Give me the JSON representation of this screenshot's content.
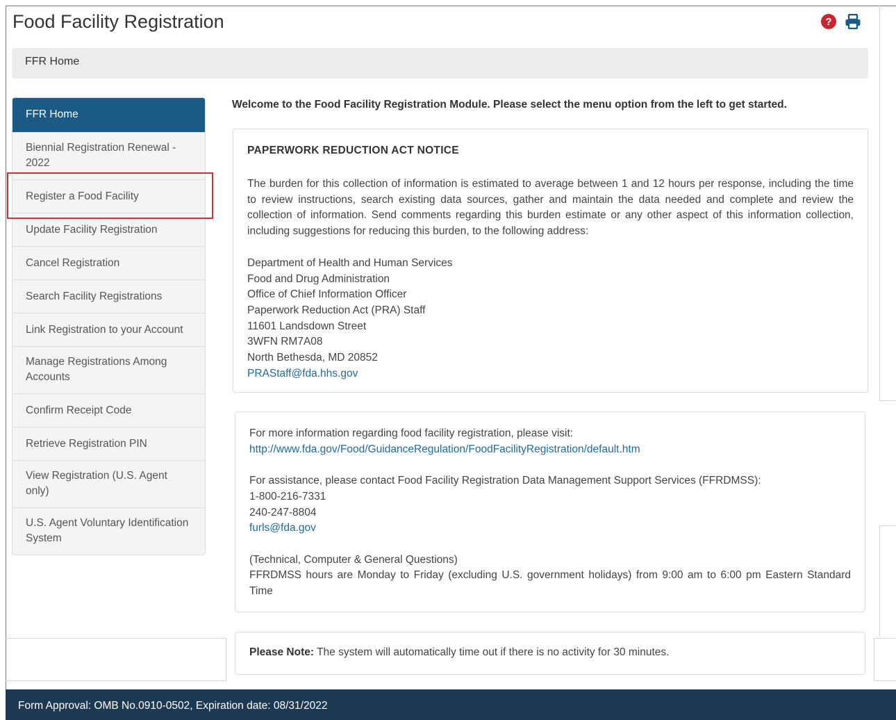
{
  "header": {
    "title": "Food Facility Registration",
    "help_icon": "question-circle-icon",
    "print_icon": "print-icon",
    "accent_color": "#c9252c",
    "icon_color": "#1b5a85"
  },
  "breadcrumb": {
    "label": "FFR Home"
  },
  "sidebar": {
    "active_color": "#1b5a85",
    "items": [
      {
        "label": "FFR Home"
      },
      {
        "label": "Biennial Registration Renewal - 2022"
      },
      {
        "label": "Register a Food Facility"
      },
      {
        "label": "Update Facility Registration"
      },
      {
        "label": "Cancel Registration"
      },
      {
        "label": "Search Facility Registrations"
      },
      {
        "label": "Link Registration to your Account"
      },
      {
        "label": "Manage Registrations Among Accounts"
      },
      {
        "label": "Confirm Receipt Code"
      },
      {
        "label": "Retrieve Registration PIN"
      },
      {
        "label": "View Registration (U.S. Agent only)"
      },
      {
        "label": "U.S. Agent Voluntary Identification System"
      }
    ]
  },
  "main": {
    "welcome": "Welcome to the Food Facility Registration Module. Please select the menu option from the left to get started.",
    "prn": {
      "title": "PAPERWORK REDUCTION ACT NOTICE",
      "body": "The burden for this collection of information is estimated to average between 1 and 12 hours per response, including the time to review instructions, search existing data sources, gather and maintain the data needed and complete and review the collection of information. Send comments regarding this burden estimate or any other aspect of this information collection, including suggestions for reducing this burden, to the following address:",
      "address": [
        "Department of Health and Human Services",
        "Food and Drug Administration",
        "Office of Chief Information Officer",
        "Paperwork Reduction Act (PRA) Staff",
        "11601 Landsdown Street",
        "3WFN RM7A08",
        "North Bethesda, MD 20852"
      ],
      "email": "PRAStaff@fda.hhs.gov"
    },
    "info": {
      "more_info": "For more information regarding food facility registration, please visit:",
      "url": "http://www.fda.gov/Food/GuidanceRegulation/FoodFacilityRegistration/default.htm",
      "assistance": "For assistance, please contact Food Facility Registration Data Management Support Services (FFRDMSS):",
      "phone1": "1-800-216-7331",
      "phone2": "240-247-8804",
      "email": "furls@fda.gov",
      "questions": "(Technical, Computer & General Questions)",
      "hours": "FFRDMSS hours are Monday to Friday (excluding U.S. government holidays) from 9:00 am to 6:00 pm Eastern Standard Time"
    },
    "note": {
      "label": "Please Note:",
      "text": " The system will automatically time out if there is no activity for 30 minutes."
    }
  },
  "footer": {
    "text": "Form Approval: OMB No.0910-0502, Expiration date: 08/31/2022",
    "bg_color": "#1d3a52"
  }
}
